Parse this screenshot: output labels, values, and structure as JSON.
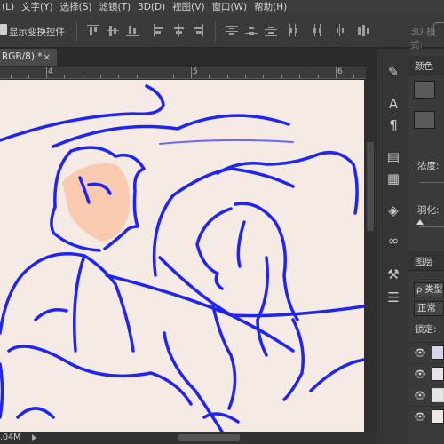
{
  "menu": {
    "items": [
      "(L)",
      "文字(Y)",
      "选择(S)",
      "滤镜(T)",
      "3D(D)",
      "视图(V)",
      "窗口(W)",
      "帮助(H)"
    ]
  },
  "options_bar": {
    "show_transform_controls": "显示变换控件",
    "mode_3d": "3D 模式:"
  },
  "document_tab": {
    "title": "RGB/8) *",
    "close": "×"
  },
  "ruler": {
    "labels": [
      "4",
      "5",
      "6"
    ]
  },
  "status": {
    "doc_size": ".04M"
  },
  "canvas": {
    "background": "#f6eae4",
    "stroke_color": "#1f24f0",
    "skin_color": "#f9c9b0"
  },
  "panels": {
    "color_title": "颜色",
    "opacity_label": "浓度:",
    "feather_label": "羽化:",
    "layers_title": "图层",
    "search_kind": "ρ 类型",
    "blend_mode": "正常",
    "lock_label": "锁定:"
  },
  "icons": {
    "strip": [
      "brush-tool-icon",
      "character-icon",
      "paragraph-icon",
      "properties-icon",
      "notes-icon",
      "3d-icon",
      "cc-libraries-icon",
      "brush-settings-icon",
      "adjust-icon"
    ]
  }
}
